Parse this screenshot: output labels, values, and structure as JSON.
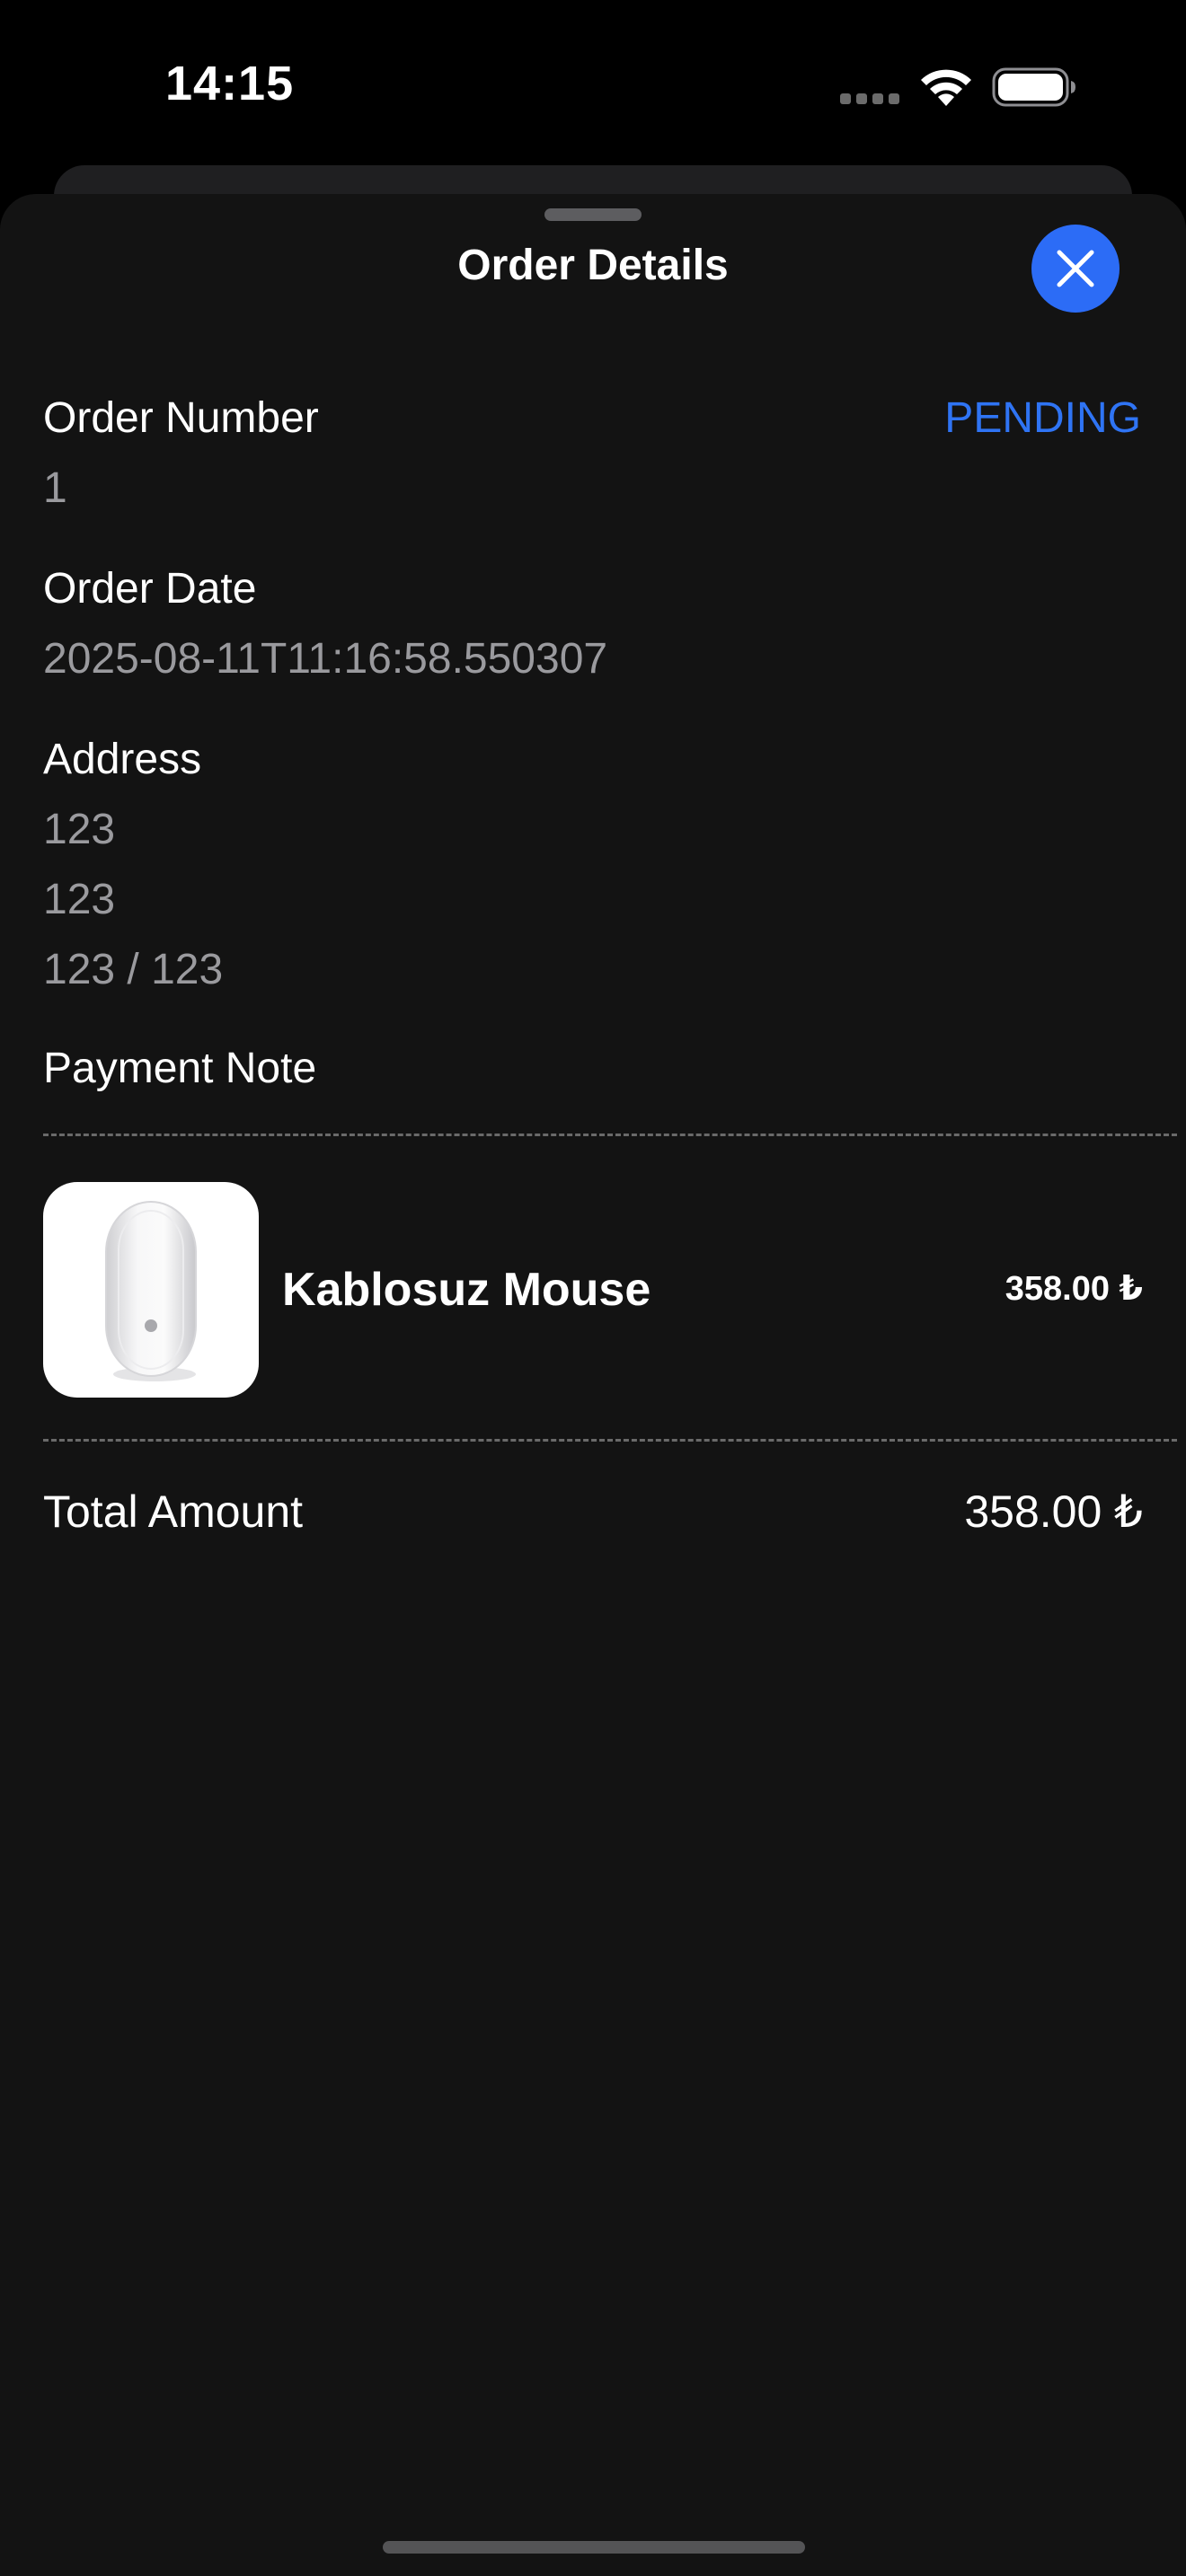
{
  "status_bar": {
    "time": "14:15"
  },
  "sheet": {
    "title": "Order Details",
    "close_icon": "close-icon"
  },
  "order": {
    "number_label": "Order Number",
    "number_value": "1",
    "status": "PENDING",
    "date_label": "Order Date",
    "date_value": "2025-08-11T11:16:58.550307",
    "address_label": "Address",
    "address_lines": [
      "123",
      "123",
      "123 / 123"
    ],
    "payment_note_label": "Payment Note"
  },
  "items": [
    {
      "name": "Kablosuz Mouse",
      "price": "358.00 ₺",
      "image_icon": "mouse-product-image"
    }
  ],
  "total": {
    "label": "Total Amount",
    "value": "358.00 ₺"
  },
  "colors": {
    "accent": "#2c6cf6",
    "status_text": "#2f74f4",
    "sheet_background": "#131313",
    "secondary_text": "#9a9a9e"
  }
}
